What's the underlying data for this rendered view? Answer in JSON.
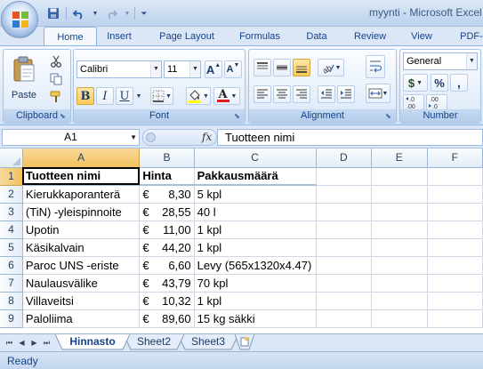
{
  "app": {
    "title": "myynti - Microsoft Excel"
  },
  "qat": {
    "items": [
      "save-icon",
      "undo-icon",
      "redo-icon",
      "customize-icon"
    ]
  },
  "ribbon_tabs": [
    "Home",
    "Insert",
    "Page Layout",
    "Formulas",
    "Data",
    "Review",
    "View",
    "PDF-"
  ],
  "active_tab": "Home",
  "clipboard": {
    "paste_label": "Paste",
    "group_label": "Clipboard"
  },
  "font": {
    "name": "Calibri",
    "size": "11",
    "bold": "B",
    "italic": "I",
    "underline": "U",
    "font_color_letter": "A",
    "grow_letter": "A",
    "shrink_letter": "A",
    "group_label": "Font"
  },
  "alignment": {
    "group_label": "Alignment"
  },
  "number": {
    "format": "General",
    "currency": "$",
    "percent": "%",
    "comma": ",",
    "inc_decimal": "←.0\n.00",
    "dec_decimal": ".00\n→.0",
    "group_label": "Number"
  },
  "formula_bar": {
    "name_box": "A1",
    "fx": "fx",
    "value": "Tuotteen nimi"
  },
  "columns": [
    "A",
    "B",
    "C",
    "D",
    "E",
    "F"
  ],
  "rows": [
    {
      "num": "1",
      "a": "Tuotteen nimi",
      "cur": "",
      "b": "Hinta",
      "c": "Pakkausmäärä"
    },
    {
      "num": "2",
      "a": "Kierukkaporanterä",
      "cur": "€",
      "b": "8,30",
      "c": "5 kpl"
    },
    {
      "num": "3",
      "a": "(TiN) -yleispinnoite",
      "cur": "€",
      "b": "28,55",
      "c": "40 l"
    },
    {
      "num": "4",
      "a": "Upotin",
      "cur": "€",
      "b": "11,00",
      "c": "1 kpl"
    },
    {
      "num": "5",
      "a": "Käsikalvain",
      "cur": "€",
      "b": "44,20",
      "c": "1 kpl"
    },
    {
      "num": "6",
      "a": "Paroc UNS -eriste",
      "cur": "€",
      "b": "6,60",
      "c": "Levy (565x1320x4.47)"
    },
    {
      "num": "7",
      "a": "Naulausvälike",
      "cur": "€",
      "b": "43,79",
      "c": "70 kpl"
    },
    {
      "num": "8",
      "a": "Villaveitsi",
      "cur": "€",
      "b": "10,32",
      "c": "1 kpl"
    },
    {
      "num": "9",
      "a": "Paloliima",
      "cur": "€",
      "b": "89,60",
      "c": "15 kg säkki"
    }
  ],
  "sheets": [
    "Hinnasto",
    "Sheet2",
    "Sheet3"
  ],
  "active_sheet": "Hinnasto",
  "status": {
    "text": "Ready"
  },
  "colors": {
    "accent": "#15428b",
    "header_text": "#1f497d",
    "selected_header": "#f1c15f"
  }
}
